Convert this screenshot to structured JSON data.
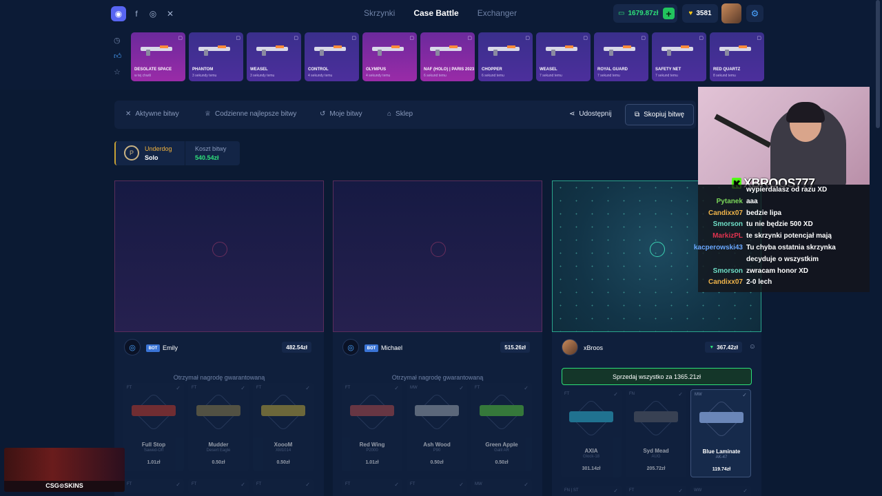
{
  "header": {
    "nav": [
      "Skrzynki",
      "Case Battle",
      "Exchanger"
    ],
    "active_nav": "Case Battle",
    "balance": "1679.87zł",
    "gems": "3581"
  },
  "drops": [
    {
      "name": "DESOLATE SPACE",
      "time": "w tej chwili",
      "color": "pink"
    },
    {
      "name": "PHANTOM",
      "time": "3 sekundy temu",
      "color": "purple"
    },
    {
      "name": "WEASEL",
      "time": "3 sekundy temu",
      "color": "purple"
    },
    {
      "name": "CONTROL",
      "time": "4 sekundy temu",
      "color": "purple"
    },
    {
      "name": "OLYMPUS",
      "time": "4 sekundy temu",
      "color": "pink"
    },
    {
      "name": "NAF (HOLO) | PARIS 2023",
      "time": "6 sekund temu",
      "color": "pink"
    },
    {
      "name": "CHOPPER",
      "time": "6 sekund temu",
      "color": "purple"
    },
    {
      "name": "WEASEL",
      "time": "7 sekund temu",
      "color": "purple"
    },
    {
      "name": "ROYAL GUARD",
      "time": "7 sekund temu",
      "color": "purple"
    },
    {
      "name": "SAFETY NET",
      "time": "7 sekund temu",
      "color": "purple"
    },
    {
      "name": "RED QUARTZ",
      "time": "8 sekund temu",
      "color": "purple"
    }
  ],
  "tabs": {
    "active": "Aktywne bitwy",
    "daily": "Codzienne najlepsze bitwy",
    "mine": "Moje bitwy",
    "shop": "Sklep",
    "share": "Udostępnij",
    "copy": "Skopiuj bitwę"
  },
  "battle": {
    "mode": "Underdog",
    "type": "Solo",
    "cost_label": "Koszt bitwy",
    "cost": "540.54zł"
  },
  "players": {
    "emily": {
      "name": "Emily",
      "bot": "BOT",
      "total": "482.54zł"
    },
    "michael": {
      "name": "Michael",
      "bot": "BOT",
      "total": "515.26zł"
    },
    "xbroos": {
      "name": "xBroos",
      "total": "367.42zł",
      "sell": "Sprzedaj wszystko za 1365.21zł"
    }
  },
  "guaranteed": "Otrzymał nagrodę gwarantowaną",
  "items": {
    "c1": [
      {
        "q": "FT",
        "name": "Full Stop",
        "type": "Sawed-Off",
        "price": "1.01zł",
        "color": "#c0392b"
      },
      {
        "q": "FT",
        "name": "Mudder",
        "type": "Desert Eagle",
        "price": "0.50zł",
        "color": "#8a7a4a"
      },
      {
        "q": "FT",
        "name": "XoooM",
        "type": "XM1014",
        "price": "0.50zł",
        "color": "#b8a23a"
      }
    ],
    "c2": [
      {
        "q": "FT",
        "name": "Red Wing",
        "type": "P2000",
        "price": "1.01zł",
        "color": "#b04a4a"
      },
      {
        "q": "MW",
        "name": "Ash Wood",
        "type": "P90",
        "price": "0.50zł",
        "color": "#9aa3ad"
      },
      {
        "q": "FT",
        "name": "Green Apple",
        "type": "Galil AR",
        "price": "0.50zł",
        "color": "#55c23a"
      }
    ],
    "c3": [
      {
        "q": "FT",
        "name": "AXIA",
        "type": "Glock-18",
        "price": "301.14zł",
        "color": "#2fb7d6"
      },
      {
        "q": "FN",
        "name": "Syd Mead",
        "type": "AUG",
        "price": "205.72zł",
        "color": "#5a5e66"
      },
      {
        "q": "MW",
        "name": "Blue Laminate",
        "type": "AK-47",
        "price": "119.74zł",
        "color": "#6a86b8"
      }
    ],
    "row2": {
      "c1": [
        "FT",
        "FT",
        "FT"
      ],
      "c2": [
        "FT",
        "FT",
        "MW"
      ],
      "c3": [
        "FN | ST",
        "FT",
        "WW"
      ]
    }
  },
  "overlay": {
    "channel": "XBROOS777",
    "chat": [
      {
        "user": "",
        "text": "wypierdalasz od razu XD",
        "color": "#ffffff"
      },
      {
        "user": "Pytanek",
        "text": "aaa",
        "color": "#7bd75a"
      },
      {
        "user": "Candixx07",
        "text": "bedzie lipa",
        "color": "#f0b44a"
      },
      {
        "user": "Smorson",
        "text": "tu nie będzie 500 XD",
        "color": "#6fe0c8"
      },
      {
        "user": "MarkizPL",
        "text": "te skrzynki potencjał mają",
        "color": "#e0334f"
      },
      {
        "user": "kacperowski43",
        "text": "Tu chyba ostatnia skrzynka",
        "color": "#6aa8ff"
      },
      {
        "user": "",
        "text": "decyduje o wszystkim",
        "color": "#ffffff"
      },
      {
        "user": "Smorson",
        "text": "zwracam honor XD",
        "color": "#6fe0c8"
      },
      {
        "user": "Candixx07",
        "text": "2-0 lech",
        "color": "#f0b44a"
      }
    ],
    "brand": "CSG⊙SKINS"
  }
}
